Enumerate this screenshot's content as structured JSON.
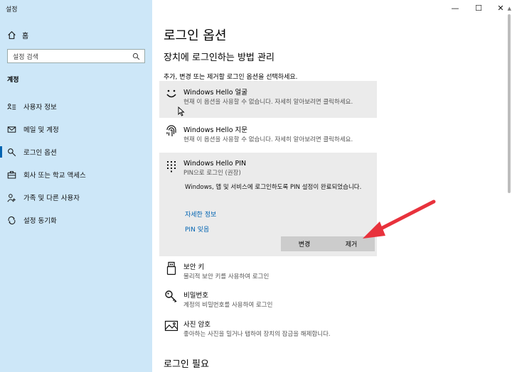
{
  "app": {
    "title": "설정"
  },
  "window_controls": {
    "minimize": "—",
    "maximize": "☐",
    "close": "✕"
  },
  "sidebar": {
    "home_label": "홈",
    "search_placeholder": "설정 검색",
    "section_label": "계정",
    "items": [
      {
        "label": "사용자 정보",
        "icon": "person-card-icon"
      },
      {
        "label": "메일 및 계정",
        "icon": "mail-icon"
      },
      {
        "label": "로그인 옵션",
        "icon": "key-icon",
        "active": true
      },
      {
        "label": "회사 또는 학교 액세스",
        "icon": "briefcase-icon"
      },
      {
        "label": "가족 및 다른 사용자",
        "icon": "people-icon"
      },
      {
        "label": "설정 동기화",
        "icon": "sync-icon"
      }
    ]
  },
  "main": {
    "title": "로그인 옵션",
    "subheading": "장치에 로그인하는 방법 관리",
    "instruction": "추가, 변경 또는 제거할 로그인 옵션을 선택하세요.",
    "options": [
      {
        "title": "Windows Hello 얼굴",
        "desc": "현재 이 옵션을 사용할 수 없습니다. 자세히 알아보려면 클릭하세요.",
        "icon": "smiley-face-icon"
      },
      {
        "title": "Windows Hello 지문",
        "desc": "현재 이 옵션을 사용할 수 없습니다. 자세히 알아보려면 클릭하세요.",
        "icon": "fingerprint-icon"
      },
      {
        "title": "Windows Hello PIN",
        "desc": "PIN으로 로그인 (권장)",
        "icon": "keypad-icon"
      },
      {
        "title": "보안 키",
        "desc": "물리적 보안 키를 사용하여 로그인",
        "icon": "usb-key-icon"
      },
      {
        "title": "비밀번호",
        "desc": "계정의 비밀번호를 사용하여 로그인",
        "icon": "key-icon"
      },
      {
        "title": "사진 암호",
        "desc": "좋아하는 사진을 밀거나 탭하여 장치의 잠금을 해제합니다.",
        "icon": "picture-icon"
      }
    ],
    "pin_detail": "Windows, 앱 및 서비스에 로그인하도록 PIN 설정이 완료되었습니다.",
    "links": {
      "more_info": "자세한 정보",
      "forgot_pin": "PIN 잊음"
    },
    "buttons": {
      "change": "변경",
      "remove": "제거"
    },
    "bottom_heading": "로그인 필요"
  },
  "colors": {
    "sidebar_bg": "#cde7f8",
    "accent": "#0063b1",
    "arrow": "#e8323c"
  }
}
